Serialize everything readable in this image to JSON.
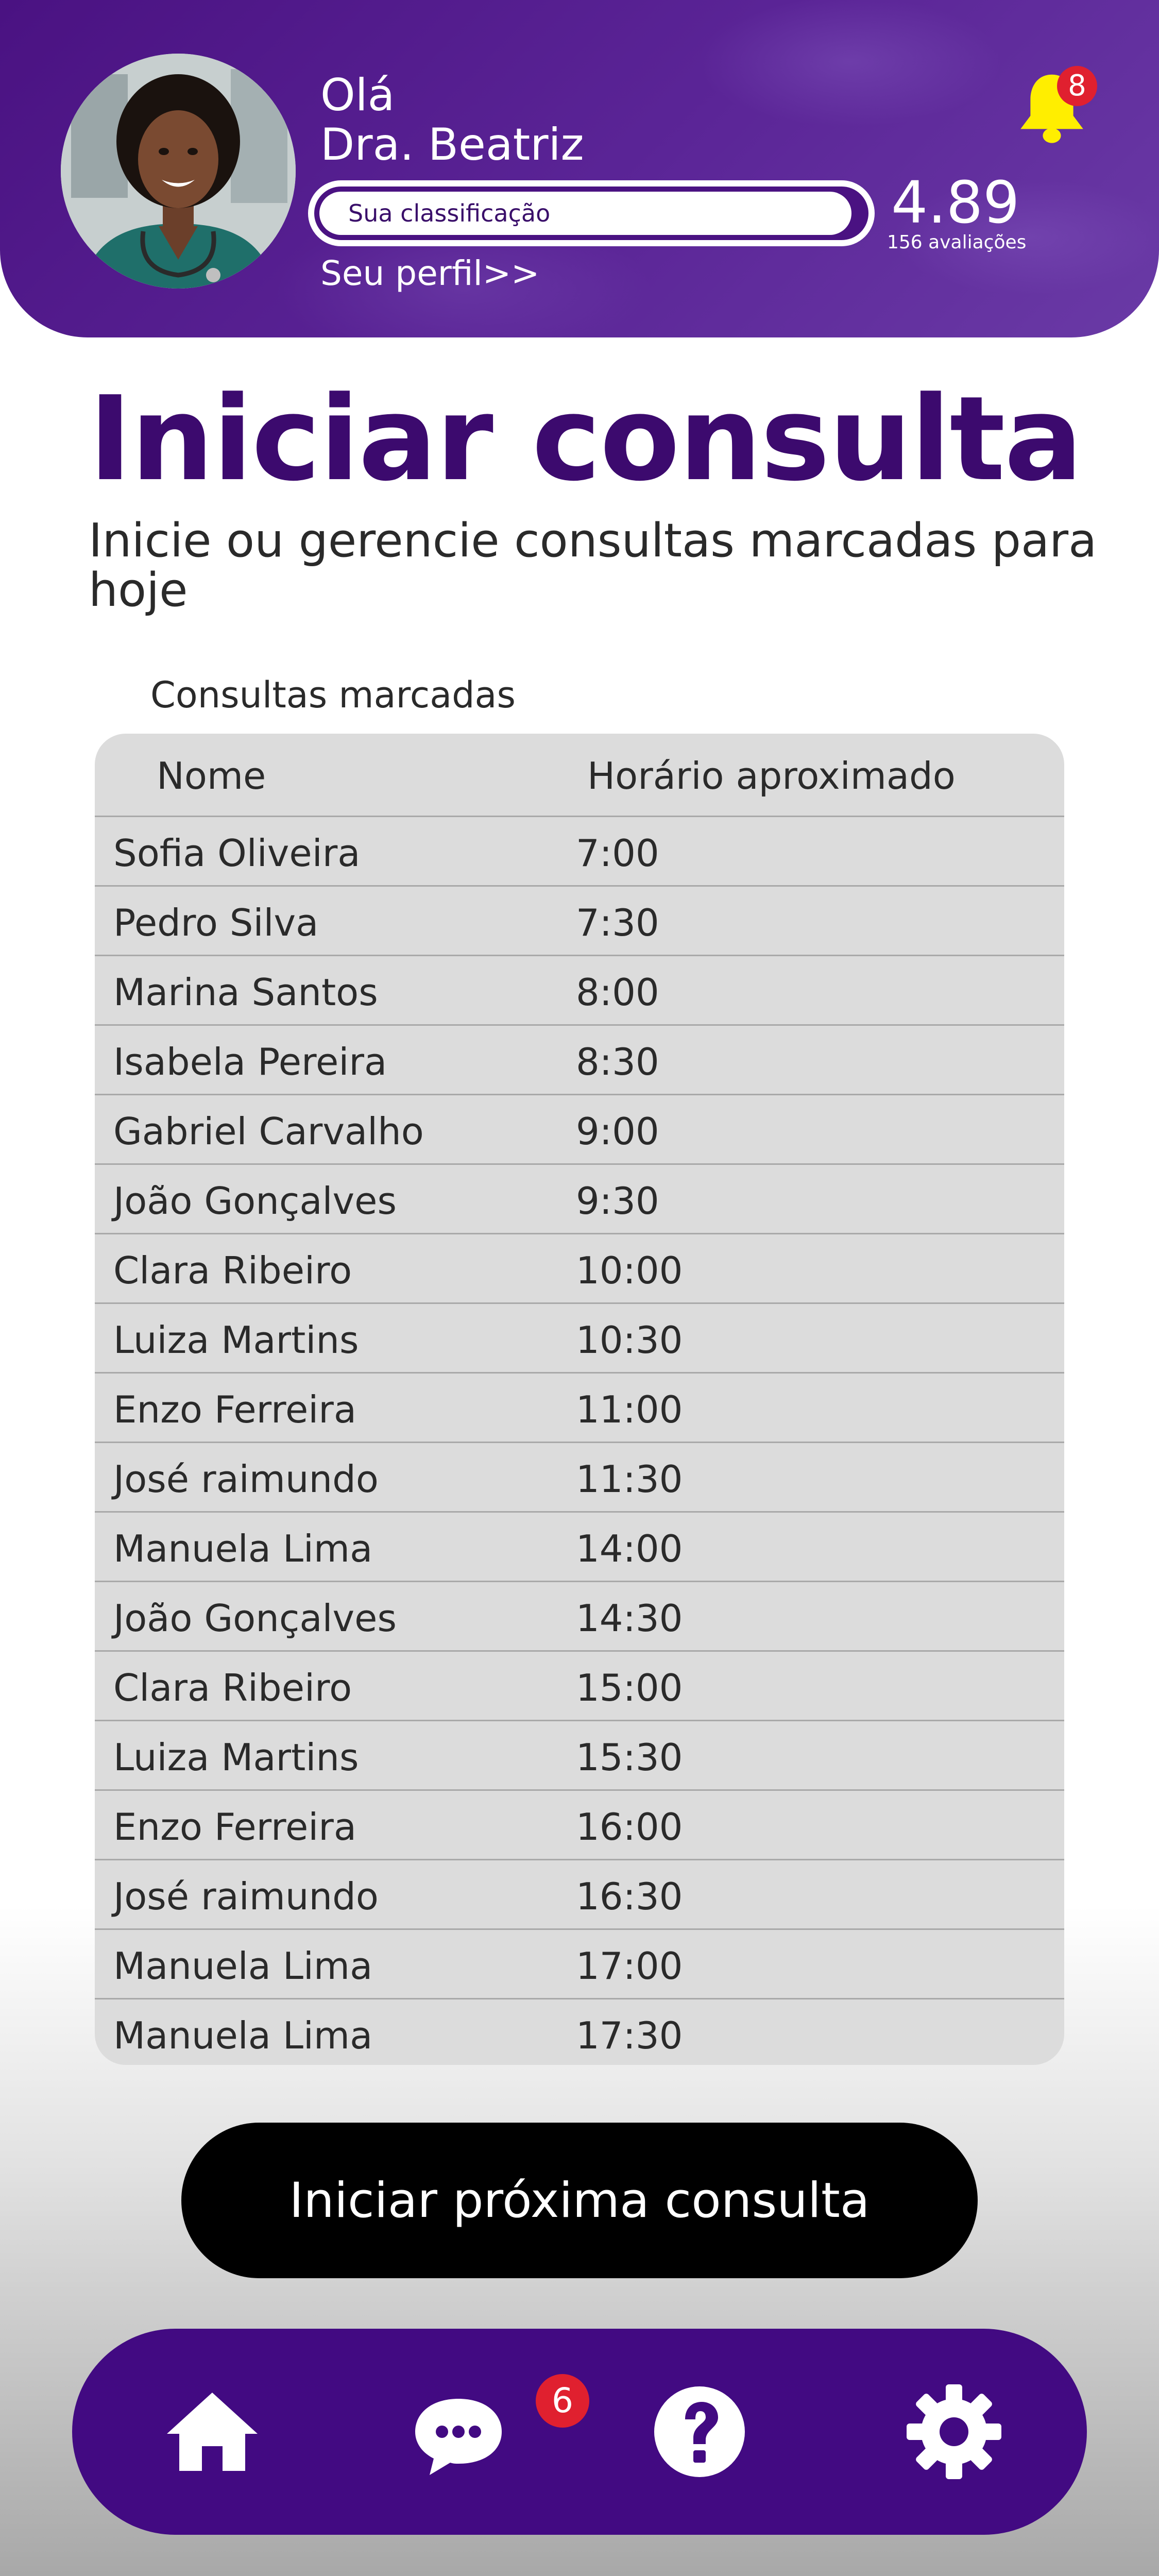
{
  "header": {
    "greeting": "Olá",
    "doctor_name": "Dra. Beatriz",
    "rating_label": "Sua classificação",
    "rating_fill": 0.978,
    "rating_score": "4.89",
    "rating_count": "156 avaliações",
    "profile_link": "Seu perfil>>",
    "notifications_count": "8",
    "bell_color": "#ffee00"
  },
  "main": {
    "title": "Iniciar consulta",
    "subtitle": "Inicie ou gerencie consultas marcadas para hoje",
    "section_label": "Consultas marcadas"
  },
  "table": {
    "columns": [
      "Nome",
      "Horário aproximado"
    ],
    "rows": [
      {
        "name": "Sofia Oliveira",
        "time": "7:00"
      },
      {
        "name": "Pedro Silva",
        "time": "7:30"
      },
      {
        "name": "Marina Santos",
        "time": "8:00"
      },
      {
        "name": "Isabela Pereira",
        "time": "8:30"
      },
      {
        "name": "Gabriel Carvalho",
        "time": "9:00"
      },
      {
        "name": "João Gonçalves",
        "time": "9:30"
      },
      {
        "name": "Clara Ribeiro",
        "time": "10:00"
      },
      {
        "name": "Luiza Martins",
        "time": "10:30"
      },
      {
        "name": "Enzo Ferreira",
        "time": "11:00"
      },
      {
        "name": "José raimundo",
        "time": "11:30"
      },
      {
        "name": "Manuela Lima",
        "time": "14:00"
      },
      {
        "name": "João Gonçalves",
        "time": "14:30"
      },
      {
        "name": "Clara Ribeiro",
        "time": "15:00"
      },
      {
        "name": "Luiza Martins",
        "time": "15:30"
      },
      {
        "name": "Enzo Ferreira",
        "time": "16:00"
      },
      {
        "name": "José raimundo",
        "time": "16:30"
      },
      {
        "name": "Manuela Lima",
        "time": "17:00"
      },
      {
        "name": "Manuela Lima",
        "time": "17:30"
      }
    ]
  },
  "cta": {
    "label": "Iniciar próxima consulta"
  },
  "nav": {
    "items": [
      {
        "icon": "home-icon"
      },
      {
        "icon": "chat-icon"
      },
      {
        "icon": "help-icon"
      },
      {
        "icon": "gear-icon"
      }
    ],
    "chat_badge": "6"
  },
  "colors": {
    "brand_purple": "#420a82",
    "title_purple": "#3c0a6e",
    "badge_red": "#e0202f",
    "table_bg": "#dcdcdc"
  }
}
